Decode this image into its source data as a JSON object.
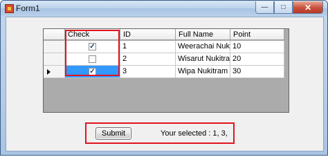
{
  "window": {
    "title": "Form1",
    "minimize_glyph": "—",
    "maximize_glyph": "□",
    "close_glyph": "✕"
  },
  "grid": {
    "columns": [
      "Check",
      "ID",
      "Full Name",
      "Point"
    ],
    "rows": [
      {
        "checked": true,
        "id": "1",
        "full_name": "Weerachai Nukit...",
        "point": "10",
        "current": false
      },
      {
        "checked": false,
        "id": "2",
        "full_name": "Wisarut Nukitram",
        "point": "20",
        "current": false
      },
      {
        "checked": true,
        "id": "3",
        "full_name": "Wipa Nukitram",
        "point": "30",
        "current": true
      }
    ],
    "check_glyph": "✓"
  },
  "actions": {
    "submit_label": "Submit",
    "status_text": "Your selected : 1, 3,"
  },
  "colors": {
    "selection": "#3399ff",
    "highlight_border": "#e0141e"
  }
}
